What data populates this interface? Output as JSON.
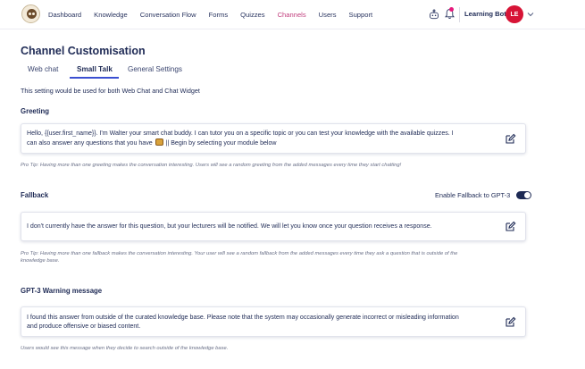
{
  "nav": {
    "items": [
      {
        "label": "Dashboard",
        "active": false
      },
      {
        "label": "Knowledge",
        "active": false
      },
      {
        "label": "Conversation Flow",
        "active": false
      },
      {
        "label": "Forms",
        "active": false
      },
      {
        "label": "Quizzes",
        "active": false
      },
      {
        "label": "Channels",
        "active": true
      },
      {
        "label": "Users",
        "active": false
      },
      {
        "label": "Support",
        "active": false
      }
    ],
    "bot_name": "Learning Bot",
    "avatar_initials": "LE",
    "accent_color": "#c2417f",
    "notification_color": "#e6197c",
    "avatar_color": "#d71436"
  },
  "page": {
    "title": "Channel Customisation",
    "tabs": [
      {
        "label": "Web chat",
        "active": false
      },
      {
        "label": "Small Talk",
        "active": true
      },
      {
        "label": "General Settings",
        "active": false
      }
    ],
    "note": "This setting would be used for both Web Chat and Chat Widget"
  },
  "greeting": {
    "title": "Greeting",
    "message_line1": "Hello, {{user.first_name}}. I'm Walter your smart chat buddy. I can tutor you on a specific topic or you can test your knowledge with the available quizzes. I",
    "message_line2_before": "can also answer any questions that you have",
    "message_line2_after": "|| Begin by selecting your module below",
    "tip": "Pro Tip: Having more than one greeting makes the conversation interesting. Users will see a random greeting from the added messages every time they start chatting!"
  },
  "fallback": {
    "title": "Fallback",
    "toggle_label": "Enable Fallback to GPT-3",
    "toggle_on": true,
    "message": "I don't currently have the answer for this question, but your lecturers will be notified. We will let you know once your question receives a response.",
    "tip_line1": "Pro Tip: Having more than one fallback makes the conversation interesting. Your user will see a random fallback from the added messages every time they ask a question that is outside of the",
    "tip_line2": "knowledge base."
  },
  "gpt3": {
    "title": "GPT-3 Warning message",
    "message_line1": "I found this answer from outside of the curated knowledge base. Please note that the system may occasionally generate incorrect or misleading information",
    "message_line2": "and produce offensive or biased content.",
    "tip": "Users would see this message when they decide to search outside of the knowledge base."
  }
}
